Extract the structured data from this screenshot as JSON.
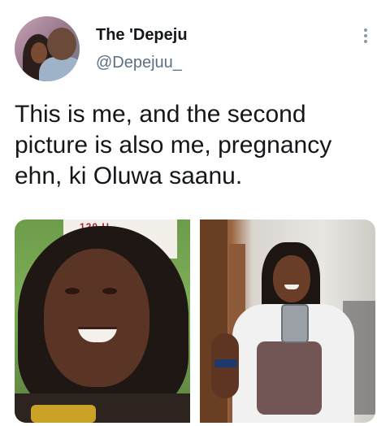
{
  "user": {
    "display_name": "The 'Depeju",
    "handle": "@Depejuu_"
  },
  "tweet": {
    "text": "This is me, and the second picture is also me, pregnancy ehn, ki Oluwa saanu."
  },
  "media": {
    "photos": [
      {
        "sign_text": "120 H"
      },
      {}
    ]
  },
  "icons": {
    "more": "more-options-icon",
    "avatar": "avatar"
  },
  "colors": {
    "text": "#14171a",
    "secondary": "#5b7083",
    "icon": "#8899a6"
  }
}
